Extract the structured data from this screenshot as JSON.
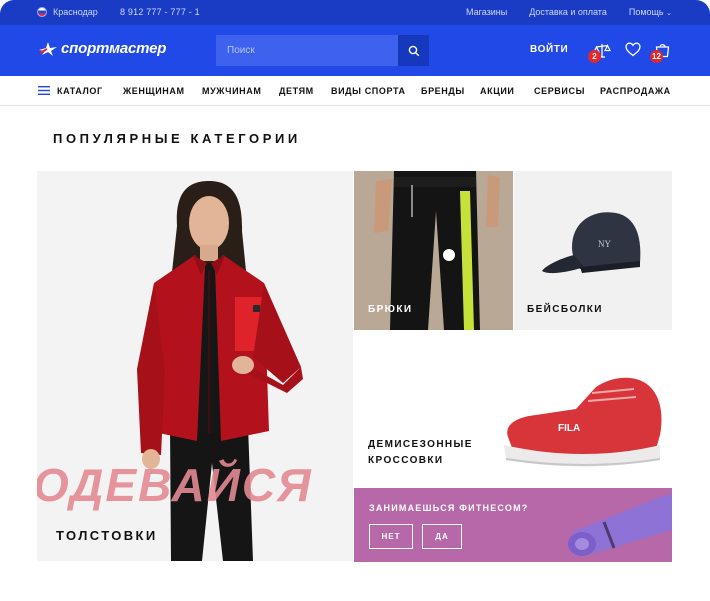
{
  "top_bar": {
    "city": "Краснодар",
    "phone": "8 912 777 - 777 - 1",
    "links": [
      "Магазины",
      "Доставка и оплата",
      "Помощь"
    ]
  },
  "header": {
    "logo_text": "спортмастер",
    "search_placeholder": "Поиск",
    "login_label": "ВОЙТИ",
    "compare_count": "2",
    "cart_count": "12"
  },
  "nav": {
    "catalog_label": "КАТАЛОГ",
    "items": [
      "ЖЕНЩИНАМ",
      "МУЖЧИНАМ",
      "ДЕТЯМ",
      "ВИДЫ СПОРТА",
      "БРЕНДЫ",
      "АКЦИИ",
      "СЕРВИСЫ",
      "РАСПРОДАЖА"
    ]
  },
  "main": {
    "section_title": "ПОПУЛЯРНЫЕ КАТЕГОРИИ",
    "tiles": {
      "hoodies": {
        "promo_word": "ОДЕВАЙСЯ",
        "label": "ТОЛСТОВКИ"
      },
      "pants": {
        "label": "БРЮКИ"
      },
      "caps": {
        "label": "БЕЙСБОЛКИ"
      },
      "shoes": {
        "label_line1": "ДЕМИСЕЗОННЫЕ",
        "label_line2": "КРОССОВКИ"
      },
      "fitness": {
        "question": "ЗАНИМАЕШЬСЯ ФИТНЕСОМ?",
        "no_label": "НЕТ",
        "yes_label": "ДА"
      }
    }
  },
  "colors": {
    "brand_blue": "#2049e8",
    "top_strip": "#1a3cc4",
    "badge_red": "#e5262a",
    "fitness_purple": "#b668a9",
    "promo_pink": "#e58a92"
  }
}
